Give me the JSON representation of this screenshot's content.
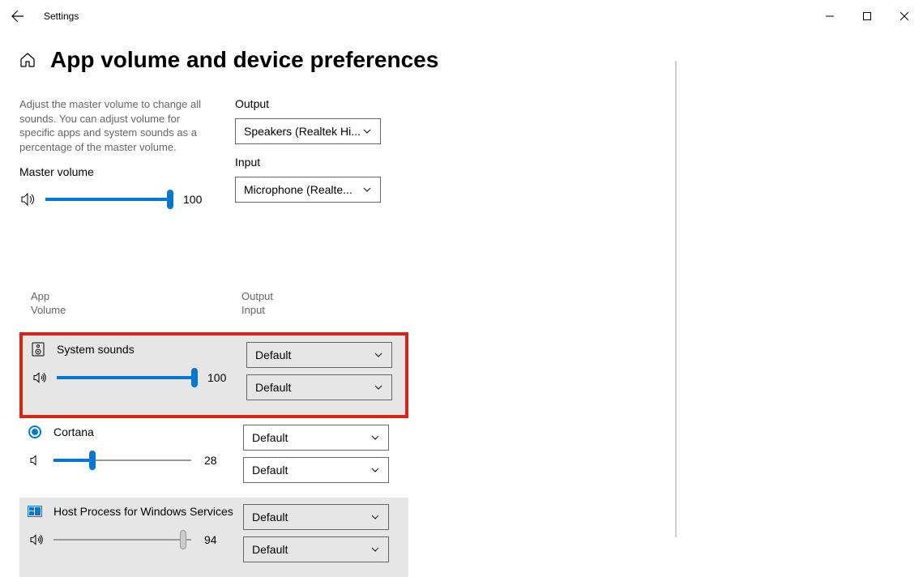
{
  "window": {
    "title": "Settings"
  },
  "page": {
    "title": "App volume and device preferences",
    "description": "Adjust the master volume to change all sounds. You can adjust volume for specific apps and system sounds as a percentage of the master volume.",
    "master_volume_label": "Master volume",
    "master_volume_value": 100
  },
  "output": {
    "label": "Output",
    "value": "Speakers (Realtek Hi..."
  },
  "input": {
    "label": "Input",
    "value": "Microphone (Realte..."
  },
  "app_header": {
    "left_line1": "App",
    "left_line2": "Volume",
    "right_line1": "Output",
    "right_line2": "Input"
  },
  "apps": [
    {
      "name": "System sounds",
      "volume": 100,
      "output": "Default",
      "input": "Default",
      "icon": "system",
      "highlighted": true,
      "muted": false
    },
    {
      "name": "Cortana",
      "volume": 28,
      "output": "Default",
      "input": "Default",
      "icon": "cortana",
      "highlighted": false,
      "muted": false
    },
    {
      "name": "Host Process for Windows Services",
      "volume": 94,
      "output": "Default",
      "input": "Default",
      "icon": "host",
      "highlighted": false,
      "muted": false,
      "gray_thumb": true
    }
  ]
}
